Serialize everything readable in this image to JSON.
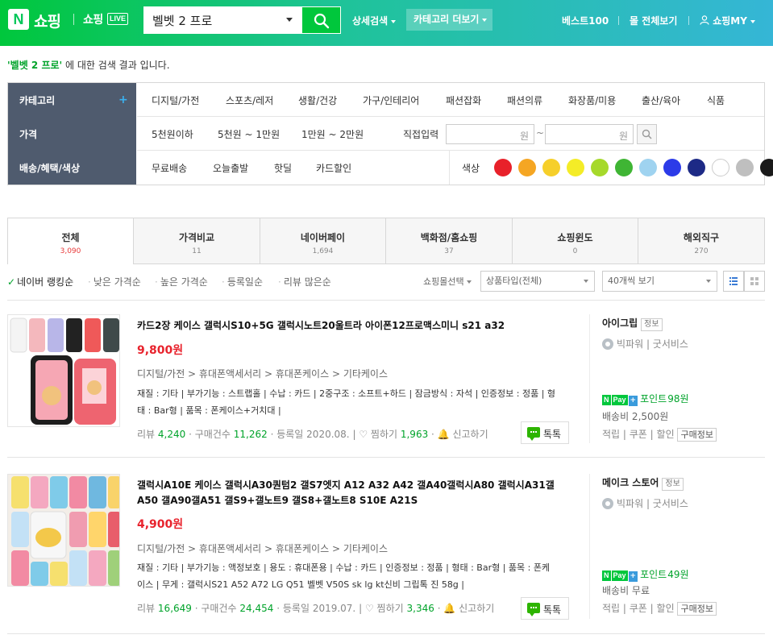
{
  "header": {
    "logo_letter": "N",
    "logo_text": "쇼핑",
    "live_text": "쇼핑",
    "live_badge": "LIVE",
    "search_value": "벨벳 2 프로",
    "detail_search": "상세검색",
    "category_more": "카테고리 더보기",
    "best100": "베스트100",
    "all_malls": "몰 전체보기",
    "my_shopping": "쇼핑MY"
  },
  "result_line": {
    "keyword": "'벨벳 2 프로'",
    "suffix": " 에 대한 검색 결과 입니다."
  },
  "filters": {
    "heads": [
      "카테고리",
      "가격",
      "배송/혜택/색상"
    ],
    "plus": "+",
    "categories": [
      "디지털/가전",
      "스포츠/레저",
      "생활/건강",
      "가구/인테리어",
      "패션잡화",
      "패션의류",
      "화장품/미용",
      "출산/육아",
      "식품"
    ],
    "price_ranges": [
      "5천원이하",
      "5천원 ~ 1만원",
      "1만원 ~ 2만원"
    ],
    "direct_input": "직접입력",
    "won": "원",
    "tilde": "~",
    "delivery": [
      "무료배송",
      "오늘출발",
      "핫딜",
      "카드할인"
    ],
    "color_label": "색상",
    "colors": [
      "#e8212a",
      "#f5a623",
      "#f6cf2a",
      "#f4ec27",
      "#a6d92b",
      "#3fb534",
      "#9fd3f0",
      "#2c3be8",
      "#1d2a86",
      "#ffffff",
      "#bfbfbf",
      "#1a1a1a"
    ]
  },
  "tabs": [
    {
      "label": "전체",
      "count": "3,090"
    },
    {
      "label": "가격비교",
      "count": "11"
    },
    {
      "label": "네이버페이",
      "count": "1,694"
    },
    {
      "label": "백화점/홈쇼핑",
      "count": "37"
    },
    {
      "label": "쇼핑윈도",
      "count": "0"
    },
    {
      "label": "해외직구",
      "count": "270"
    }
  ],
  "sort": {
    "options": [
      "네이버 랭킹순",
      "낮은 가격순",
      "높은 가격순",
      "등록일순",
      "리뷰 많은순"
    ],
    "mall_select": "쇼핑몰선택",
    "product_type": "상품타입(전체)",
    "view_count": "40개씩 보기"
  },
  "products": [
    {
      "title": "카드2장 케이스 갤럭시S10+5G 갤럭시노트20울트라 아이폰12프로맥스미니 s21 a32",
      "price": "9,800원",
      "category": "디지털/가전 > 휴대폰액세서리 > 휴대폰케이스 > 기타케이스",
      "specs": "재질 : 기타 | 부가기능 : 스트랩홀 | 수납 : 카드 | 2중구조 : 소프트+하드 | 잠금방식 : 자석 | 인증정보 : 정품 | 형태 : Bar형 | 품목 : 폰케이스+거치대 |",
      "review_label": "리뷰",
      "review": "4,240",
      "buy_label": "구매건수",
      "buy": "11,262",
      "date_label": "등록일",
      "date": "2020.08.",
      "like_label": "찜하기",
      "like": "1,963",
      "report": "신고하기",
      "talk": "톡톡",
      "mall": "아이그립",
      "mall_info": "정보",
      "grade": "빅파워",
      "grade2": "굿서비스",
      "point_label": "포인트",
      "point": "98원",
      "shipping": "배송비 2,500원",
      "actions": [
        "적립",
        "쿠폰",
        "할인"
      ],
      "buy_info": "구매정보"
    },
    {
      "title": "갤럭시A10E 케이스 갤럭시A30퀀텀2 갤S7엣지 A12 A32 A42 갤A40갤럭시A80 갤럭시A31갤A50 갤A90갤A51 갤S9+갤노트9 갤S8+갤노트8 S10E A21S",
      "price": "4,900원",
      "category": "디지털/가전 > 휴대폰액세서리 > 휴대폰케이스 > 기타케이스",
      "specs": "재질 : 기타 | 부가기능 : 액정보호 | 용도 : 휴대폰용 | 수납 : 카드 | 인증정보 : 정품 | 형태 : Bar형 | 품목 : 폰케이스 | 무게 : 갤럭시S21 A52 A72 LG Q51 벨벳 V50S sk lg kt신비 그립톡 진 58g |",
      "review_label": "리뷰",
      "review": "16,649",
      "buy_label": "구매건수",
      "buy": "24,454",
      "date_label": "등록일",
      "date": "2019.07.",
      "like_label": "찜하기",
      "like": "3,346",
      "report": "신고하기",
      "talk": "톡톡",
      "mall": "메이크 스토어",
      "mall_info": "정보",
      "grade": "빅파워",
      "grade2": "굿서비스",
      "point_label": "포인트",
      "point": "49원",
      "shipping": "배송비 무료",
      "actions": [
        "적립",
        "쿠폰",
        "할인"
      ],
      "buy_info": "구매정보"
    }
  ]
}
